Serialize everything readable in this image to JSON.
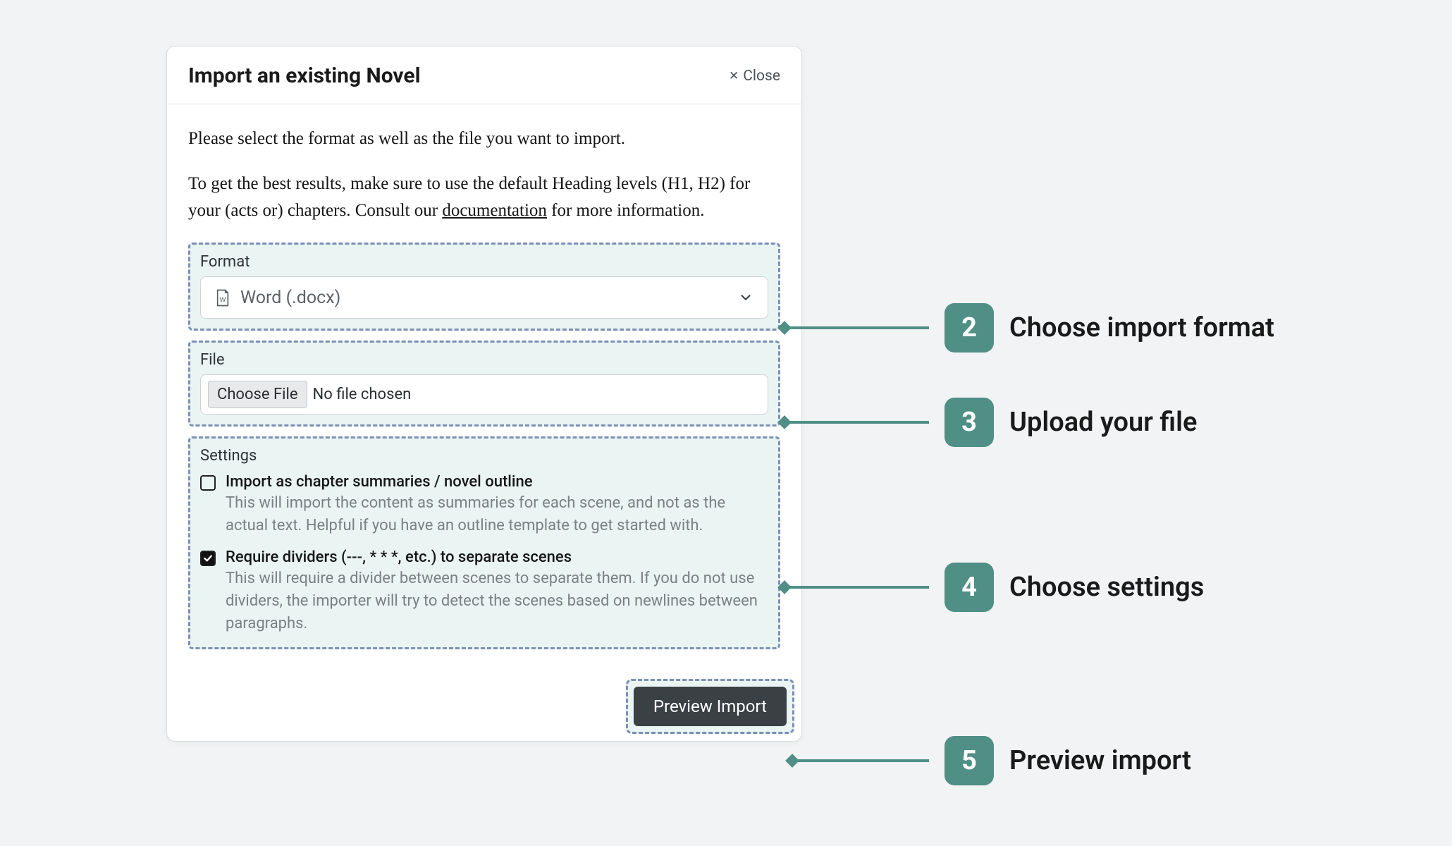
{
  "dialog": {
    "title": "Import an existing Novel",
    "close_label": "Close",
    "intro_p1": "Please select the format as well as the file you want to import.",
    "intro_p2_prefix": "To get the best results, make sure to use the default Heading levels (H1, H2) for your (acts or) chapters. Consult our ",
    "intro_link": "documentation",
    "intro_p2_suffix": " for more information."
  },
  "format": {
    "label": "Format",
    "selected": "Word (.docx)"
  },
  "file": {
    "label": "File",
    "choose_button": "Choose File",
    "status": "No file chosen"
  },
  "settings": {
    "label": "Settings",
    "items": [
      {
        "title": "Import as chapter summaries / novel outline",
        "desc": "This will import the content as summaries for each scene, and not as the actual text. Helpful if you have an outline template to get started with.",
        "checked": false
      },
      {
        "title": "Require dividers (---, * * *, etc.) to separate scenes",
        "desc": "This will require a divider between scenes to separate them. If you do not use dividers, the importer will try to detect the scenes based on newlines between paragraphs.",
        "checked": true
      }
    ]
  },
  "footer": {
    "preview_button": "Preview Import"
  },
  "callouts": [
    {
      "num": "2",
      "text": "Choose import format"
    },
    {
      "num": "3",
      "text": "Upload your file"
    },
    {
      "num": "4",
      "text": "Choose settings"
    },
    {
      "num": "5",
      "text": "Preview import"
    }
  ]
}
